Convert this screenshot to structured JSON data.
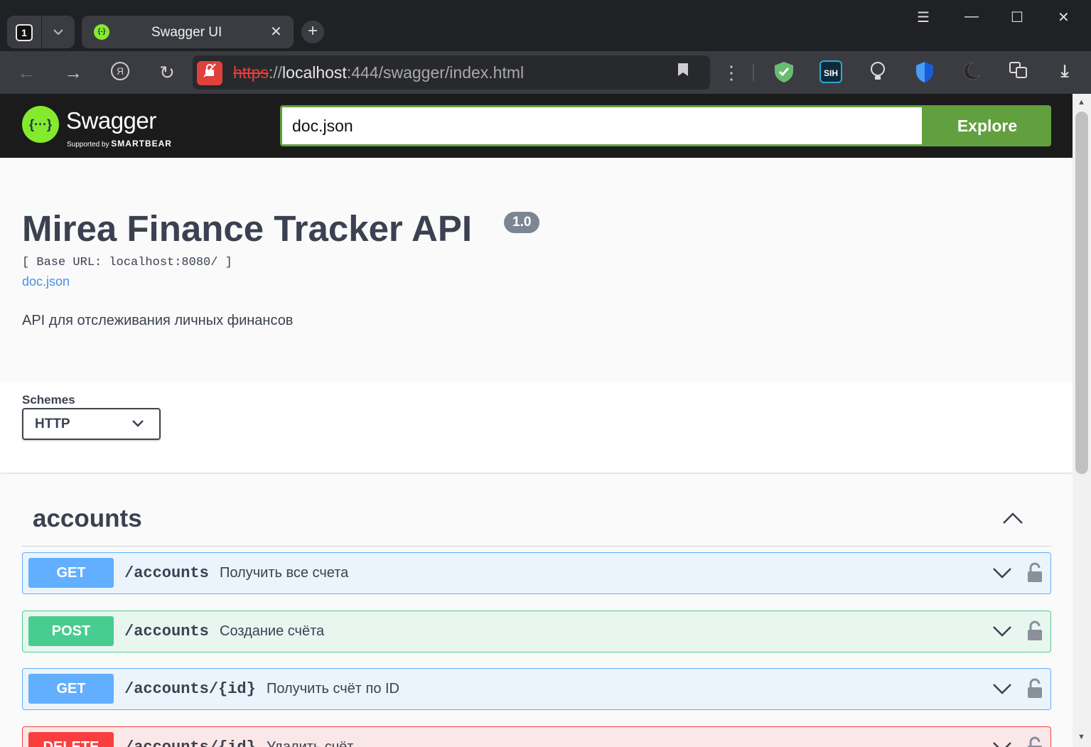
{
  "browser": {
    "tab_count": "1",
    "tab_title": "Swagger UI",
    "url_protocol": "https",
    "url_sep": "://",
    "url_host": "localhost",
    "url_rest": ":444/swagger/index.html",
    "ext_badge": "SIH"
  },
  "topbar": {
    "logo_text": "Swagger",
    "logo_sub_prefix": "Supported by",
    "logo_sub_brand": "SMARTBEAR",
    "search_value": "doc.json",
    "explore_label": "Explore",
    "brand_color": "#85ea2d",
    "accent_color": "#62a03f"
  },
  "info": {
    "title": "Mirea Finance Tracker API",
    "version": "1.0",
    "base_url": "[ Base URL: localhost:8080/ ]",
    "doc_link": "doc.json",
    "description": "API для отслеживания личных финансов"
  },
  "schemes": {
    "label": "Schemes",
    "selected": "HTTP"
  },
  "tag": {
    "name": "accounts"
  },
  "operations": [
    {
      "method": "GET",
      "path": "/accounts",
      "summary": "Получить все счета",
      "color": "#61affe"
    },
    {
      "method": "POST",
      "path": "/accounts",
      "summary": "Создание счёта",
      "color": "#49cc90"
    },
    {
      "method": "GET",
      "path": "/accounts/{id}",
      "summary": "Получить счёт по ID",
      "color": "#61affe"
    },
    {
      "method": "DELETE",
      "path": "/accounts/{id}",
      "summary": "Удалить счёт",
      "color": "#f93e3e"
    }
  ]
}
